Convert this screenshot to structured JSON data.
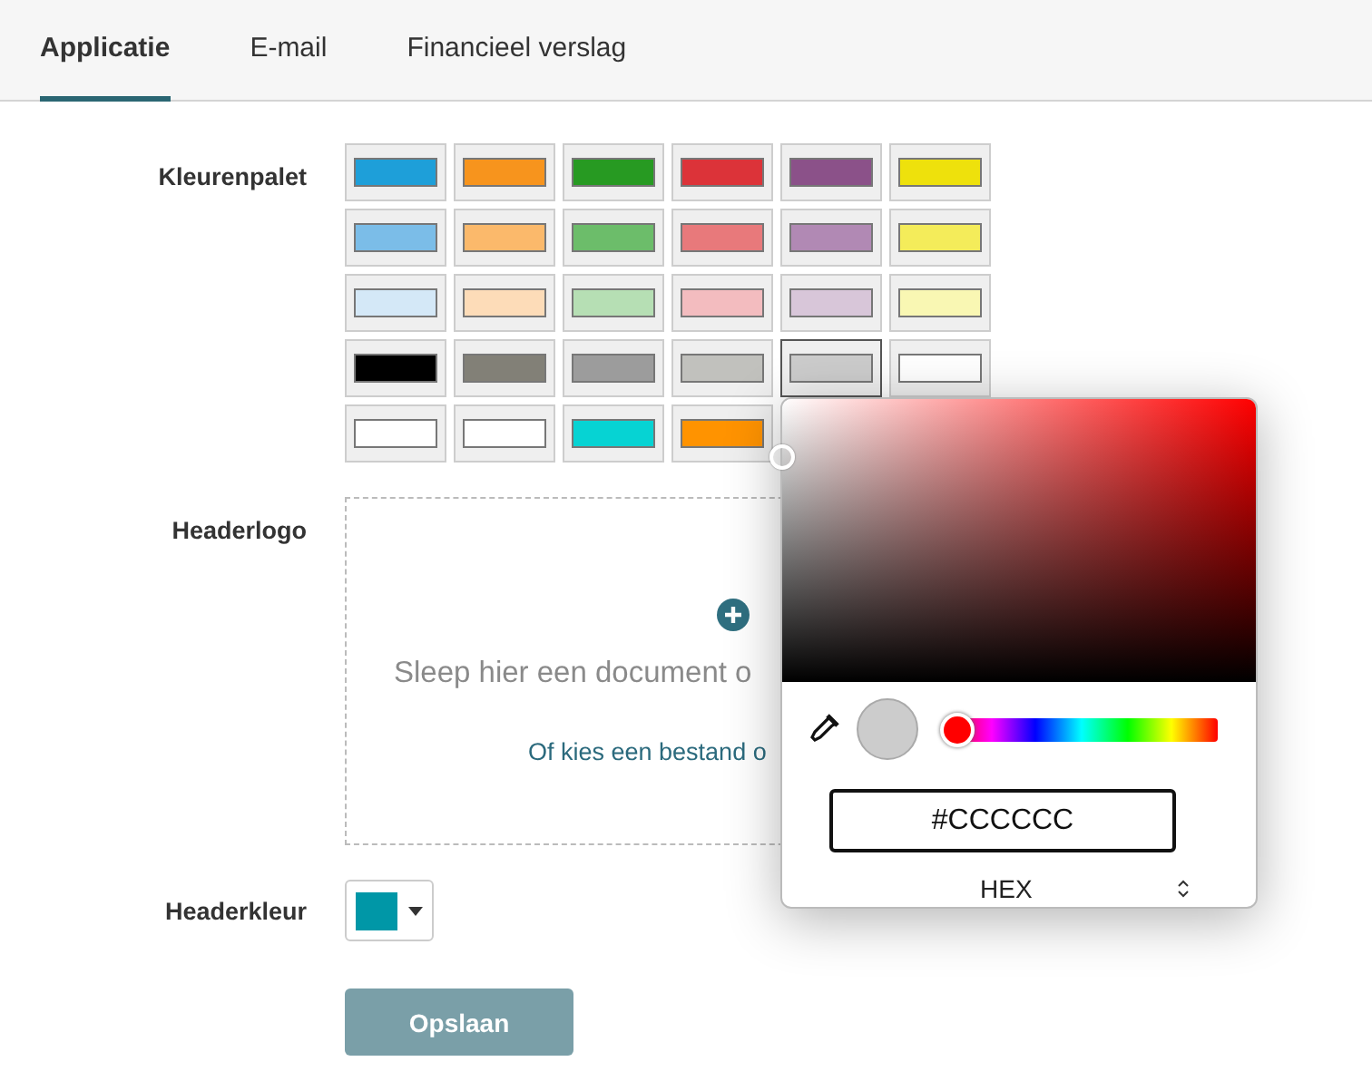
{
  "tabs": [
    {
      "label": "Applicatie",
      "selected": true
    },
    {
      "label": "E-mail",
      "selected": false
    },
    {
      "label": "Financieel verslag",
      "selected": false
    }
  ],
  "palette": {
    "label": "Kleurenpalet",
    "rows": [
      [
        {
          "color": "#1e9fd9",
          "selected": false
        },
        {
          "color": "#f7941d",
          "selected": false
        },
        {
          "color": "#279a22",
          "selected": false
        },
        {
          "color": "#dc3339",
          "selected": false
        },
        {
          "color": "#8b5189",
          "selected": false
        },
        {
          "color": "#eee10c",
          "selected": false
        }
      ],
      [
        {
          "color": "#7bbde8",
          "selected": false
        },
        {
          "color": "#fbb96b",
          "selected": false
        },
        {
          "color": "#6cbd6a",
          "selected": false
        },
        {
          "color": "#e8797b",
          "selected": false
        },
        {
          "color": "#b189b4",
          "selected": false
        },
        {
          "color": "#f4ec5a",
          "selected": false
        }
      ],
      [
        {
          "color": "#d4e8f7",
          "selected": false
        },
        {
          "color": "#fddcb8",
          "selected": false
        },
        {
          "color": "#b6dfb4",
          "selected": false
        },
        {
          "color": "#f3bcbf",
          "selected": false
        },
        {
          "color": "#d8c6d9",
          "selected": false
        },
        {
          "color": "#f9f7b3",
          "selected": false
        }
      ],
      [
        {
          "color": "#000000",
          "selected": false
        },
        {
          "color": "#828077",
          "selected": false
        },
        {
          "color": "#9c9c9c",
          "selected": false
        },
        {
          "color": "#c1c1bd",
          "selected": false
        },
        {
          "color": "#cccccc",
          "selected": true
        },
        {
          "color": "#ffffff",
          "selected": false
        }
      ],
      [
        {
          "color": "#ffffff",
          "selected": false
        },
        {
          "color": "#ffffff",
          "selected": false
        },
        {
          "color": "#06d3d3",
          "selected": false
        },
        {
          "color": "#ff9300",
          "selected": false
        }
      ]
    ]
  },
  "header_logo": {
    "label": "Headerlogo",
    "drop_text": "Sleep hier een document o",
    "link": "Of kies een bestand o"
  },
  "header_color": {
    "label": "Headerkleur",
    "color": "#0097a7"
  },
  "save_button": "Opslaan",
  "color_picker": {
    "hue": {
      "level": 0
    },
    "value": "#CCCCCC",
    "format": "HEX"
  }
}
